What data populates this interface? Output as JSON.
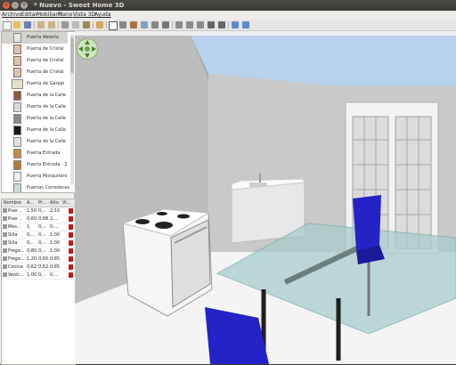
{
  "window": {
    "title": "* Nuevo - Sweet Home 3D"
  },
  "menu": [
    "Archivo",
    "Editar",
    "Mobiliario",
    "Plano",
    "Vista 3D",
    "Ayuda"
  ],
  "catalog": {
    "items": [
      {
        "label": "Puerta Abierta",
        "icon": "door-open-icon",
        "selected": true
      },
      {
        "label": "Puerta de Cristal",
        "icon": "glass-door-icon"
      },
      {
        "label": "Puerta de Cristal",
        "icon": "glass-door-icon"
      },
      {
        "label": "Puerta de Cristal",
        "icon": "glass-door-icon"
      },
      {
        "label": "Puerta de Garaje",
        "icon": "garage-door-icon"
      },
      {
        "label": "Puerta de la Calle",
        "icon": "front-door-icon"
      },
      {
        "label": "Puerta de la Calle",
        "icon": "front-door-icon"
      },
      {
        "label": "Puerta de la Calle",
        "icon": "front-door-icon"
      },
      {
        "label": "Puerta de la Calle",
        "icon": "front-door-icon"
      },
      {
        "label": "Puerta de la Calle",
        "icon": "front-door-icon"
      },
      {
        "label": "Puerta Entrada",
        "icon": "entrance-door-icon"
      },
      {
        "label": "Puerta Entrada - 2",
        "icon": "entrance-door-icon"
      },
      {
        "label": "Puerta Mosquitero",
        "icon": "screen-door-icon"
      },
      {
        "label": "Puertas Correderas",
        "icon": "sliding-door-icon"
      }
    ]
  },
  "furniture_table": {
    "headers": [
      "Nombre",
      "A...",
      "Pr...",
      "Alto",
      "Vi..."
    ],
    "rows": [
      {
        "name": "Puer...",
        "w": "1,50",
        "d": "0,...",
        "h": "2,10"
      },
      {
        "name": "Puer...",
        "w": "0,60",
        "d": "0,68",
        "h": "2,..."
      },
      {
        "name": "Mes...",
        "w": "1,",
        "d": "0,...",
        "h": "0,..."
      },
      {
        "name": "Silla",
        "w": "0,...",
        "d": "0,...",
        "h": "1,00"
      },
      {
        "name": "Silla",
        "w": "0,...",
        "d": "0,...",
        "h": "1,00"
      },
      {
        "name": "Frego...",
        "w": "0,80",
        "d": "0,...",
        "h": "1,00"
      },
      {
        "name": "Frego...",
        "w": "1,20",
        "d": "0,60",
        "h": "0,85"
      },
      {
        "name": "Cocina",
        "w": "0,62",
        "d": "0,62",
        "h": "0,85"
      },
      {
        "name": "Venti...",
        "w": "1,00",
        "d": "0,...",
        "h": "0,..."
      }
    ]
  },
  "colors": {
    "sky": "#b6d2ec",
    "wall": "#c8c8c8",
    "floor": "#f4f4f4",
    "chair": "#2323c8",
    "glass": "#a9cccc"
  }
}
